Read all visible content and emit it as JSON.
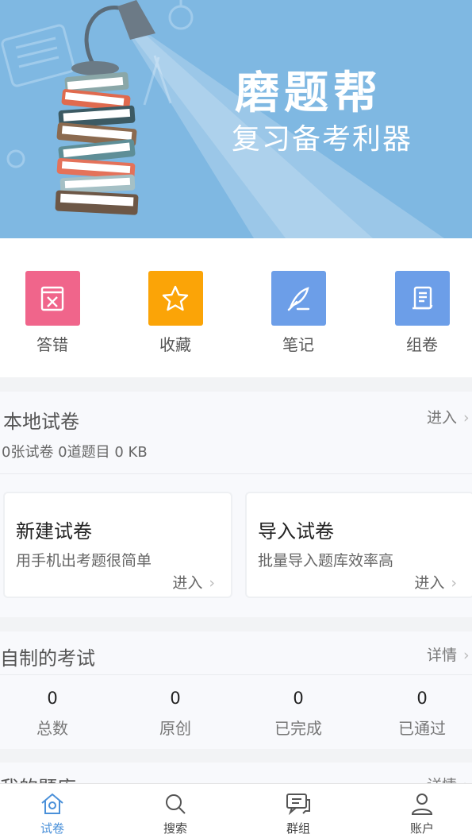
{
  "banner": {
    "title": "磨题帮",
    "subtitle": "复习备考利器"
  },
  "quick_actions": [
    {
      "label": "答错",
      "icon": "wrong-answers-icon",
      "color": "#f0658b"
    },
    {
      "label": "收藏",
      "icon": "star-icon",
      "color": "#fba407"
    },
    {
      "label": "笔记",
      "icon": "feather-pen-icon",
      "color": "#6c9ee8"
    },
    {
      "label": "组卷",
      "icon": "scroll-paper-icon",
      "color": "#6c9ee8"
    }
  ],
  "local_papers": {
    "title": "本地试卷",
    "enter_label": "进入",
    "stats": "0张试卷 0道题目 0 KB",
    "cards": [
      {
        "title": "新建试卷",
        "subtitle": "用手机出考题很简单",
        "enter_label": "进入"
      },
      {
        "title": "导入试卷",
        "subtitle": "批量导入题库效率高",
        "enter_label": "进入"
      }
    ]
  },
  "custom_exams": {
    "title": "自制的考试",
    "details_label": "详情",
    "stats": [
      {
        "value": "0",
        "label": "总数"
      },
      {
        "value": "0",
        "label": "原创"
      },
      {
        "value": "0",
        "label": "已完成"
      },
      {
        "value": "0",
        "label": "已通过"
      }
    ]
  },
  "my_bank": {
    "title": "我的题库",
    "details_label": "详情"
  },
  "tabbar": {
    "accent": "#4a90d9",
    "items": [
      {
        "label": "试卷",
        "icon": "home-icon",
        "active": true
      },
      {
        "label": "搜索",
        "icon": "search-icon",
        "active": false
      },
      {
        "label": "群组",
        "icon": "chat-icon",
        "active": false
      },
      {
        "label": "账户",
        "icon": "user-icon",
        "active": false
      }
    ]
  }
}
